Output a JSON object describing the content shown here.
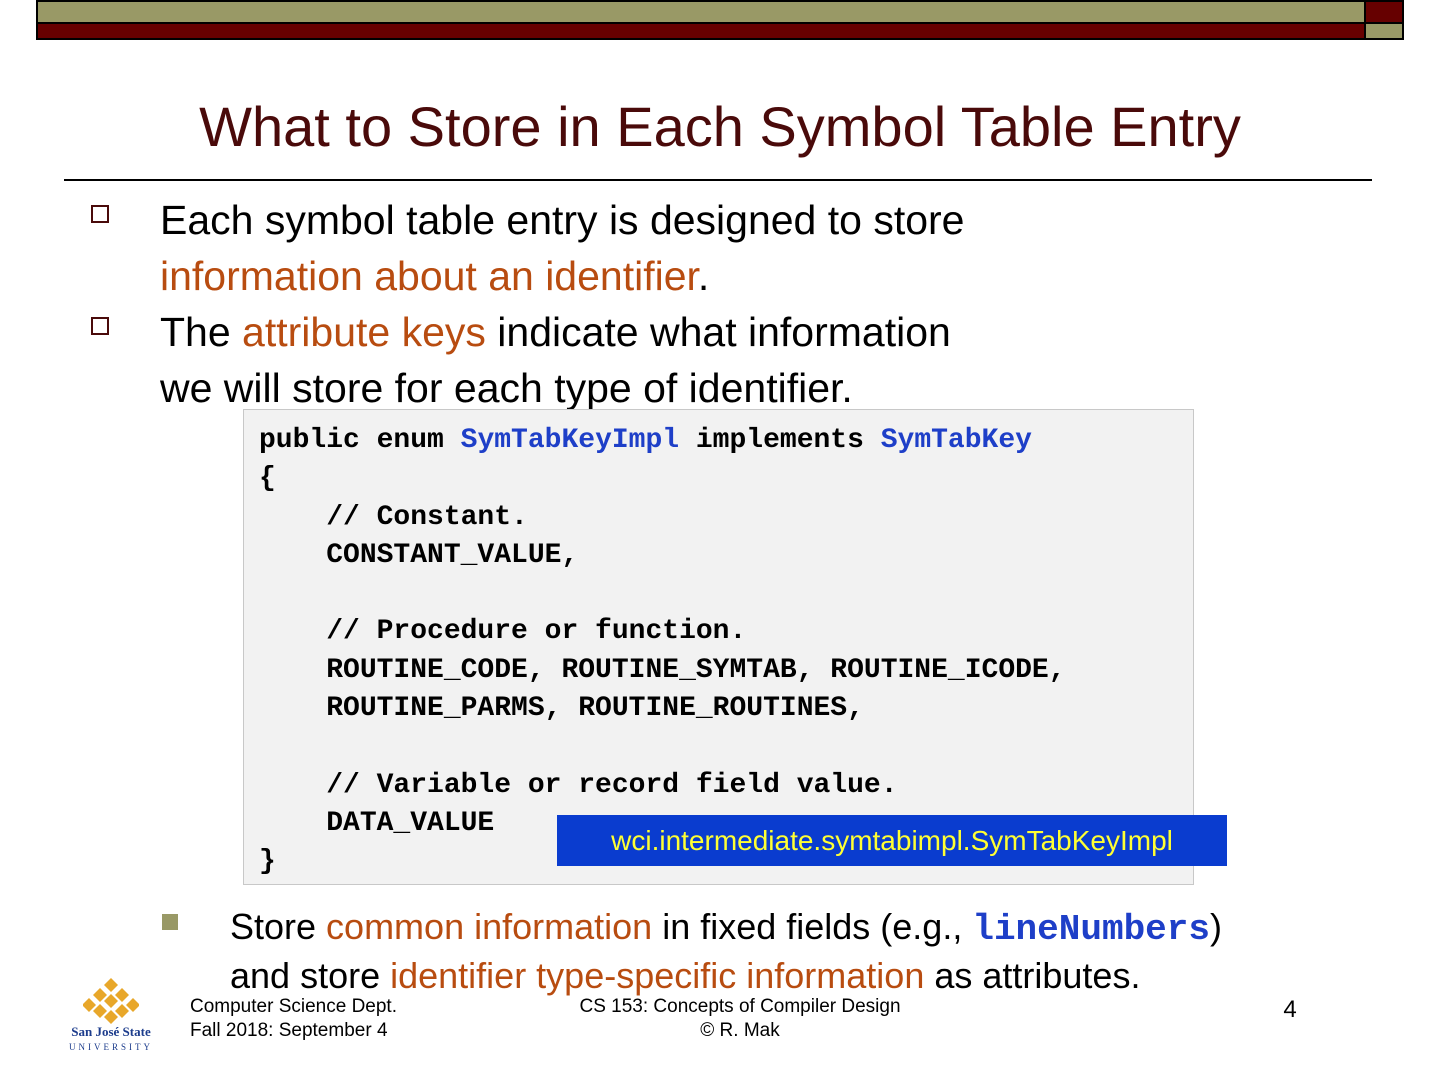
{
  "slide": {
    "title": "What to Store in Each Symbol Table Entry",
    "bullets": [
      {
        "parts": [
          {
            "text": "Each symbol table entry is designed to store"
          },
          {
            "text": "information about an identifier"
          },
          {
            "text": "."
          }
        ]
      },
      {
        "parts": [
          {
            "text": "The "
          },
          {
            "text": "attribute keys"
          },
          {
            "text": " indicate what information"
          },
          {
            "text": "we will store for each type of identifier."
          }
        ]
      }
    ],
    "code": {
      "lines": [
        {
          "a": "public enum ",
          "b": "SymTabKeyImpl",
          "c": " implements ",
          "d": "SymTabKey"
        },
        "{",
        "    // Constant.",
        "    CONSTANT_VALUE,",
        "",
        "    // Procedure or function.",
        "    ROUTINE_CODE, ROUTINE_SYMTAB, ROUTINE_ICODE,",
        "    ROUTINE_PARMS, ROUTINE_ROUTINES,",
        "",
        "    // Variable or record field value.",
        "    DATA_VALUE",
        "}"
      ]
    },
    "callout": "wci.intermediate.symtabimpl.SymTabKeyImpl",
    "sub_bullet": {
      "parts": [
        {
          "text": "Store "
        },
        {
          "text": "common information"
        },
        {
          "text": " in fixed fields (e.g., "
        },
        {
          "text": "lineNumbers"
        },
        {
          "text": ")"
        },
        {
          "text": "and store "
        },
        {
          "text": "identifier type-specific information"
        },
        {
          "text": " as attributes."
        }
      ]
    }
  },
  "footer": {
    "left_line1": "Computer Science Dept.",
    "left_line2": "Fall 2018: September 4",
    "center_line1": "CS 153: Concepts of Compiler Design",
    "center_line2": "© R. Mak",
    "page_number": "4",
    "logo_text": "San José State",
    "logo_sub": "UNIVERSITY"
  },
  "colors": {
    "maroon": "#660000",
    "olive": "#999966",
    "highlight": "#b84c10",
    "code_keyword_blue": "#1e3fc8",
    "callout_bg": "#0a3ccf",
    "callout_text": "#ffff33"
  }
}
